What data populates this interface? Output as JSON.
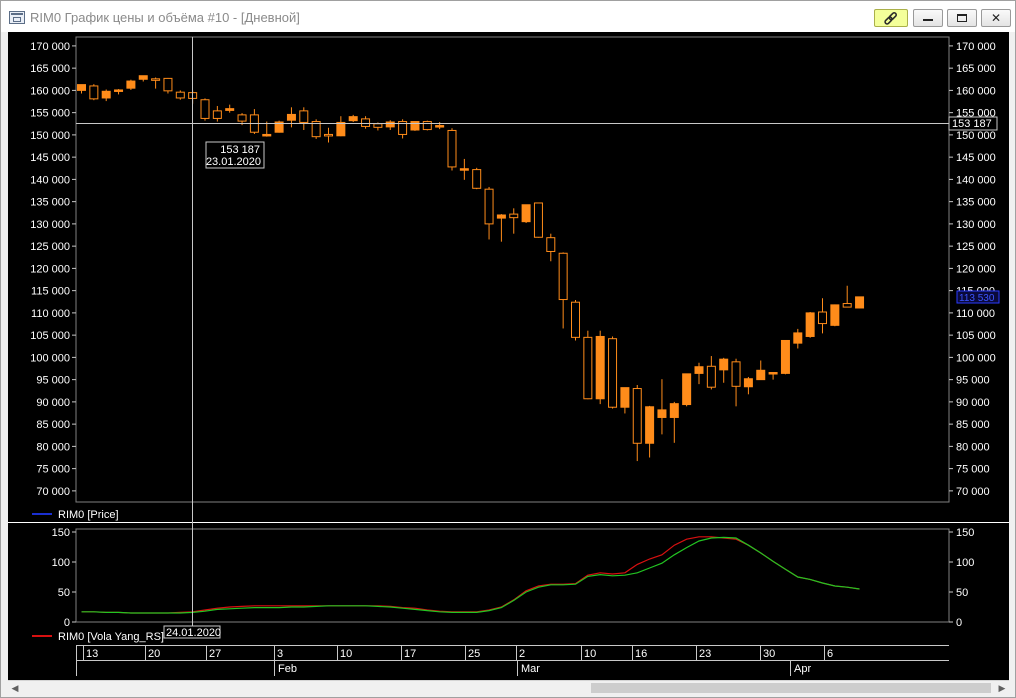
{
  "window": {
    "title": "RIM0 График цены и объёма #10 - [Дневной]"
  },
  "toolbar": {
    "link_icon": "link-icon",
    "minimize_icon": "minimize-icon",
    "maximize_icon": "maximize-icon",
    "close_icon": "close-icon"
  },
  "colors": {
    "background": "#000000",
    "grid": "#5a5a5a",
    "axis_text": "#ffffff",
    "candle_up": "#ff8c1a",
    "candle_down_border": "#ff8c1a",
    "crosshair": "#c8c8c8",
    "vola_red": "#d81010",
    "vola_green": "#22c422",
    "legend_blue": "#1a2fd0"
  },
  "crosshair": {
    "price_label": "153 187",
    "date_label": "23.01.2020",
    "bottom_date_label": "24.01.2020",
    "right_label": "153 187"
  },
  "last_price_label": "113 530",
  "chart_data": [
    {
      "type": "candlestick",
      "legend": "RIM0 [Price]",
      "y_ticks": [
        "70 000",
        "75 000",
        "80 000",
        "85 000",
        "90 000",
        "95 000",
        "100 000",
        "105 000",
        "110 000",
        "115 000",
        "120 000",
        "125 000",
        "130 000",
        "135 000",
        "140 000",
        "145 000",
        "150 000",
        "155 000",
        "160 000",
        "165 000",
        "170 000"
      ],
      "ylim": [
        67500,
        172000
      ],
      "candles": [
        {
          "o": 160000,
          "h": 161200,
          "l": 159300,
          "c": 161300
        },
        {
          "o": 161000,
          "h": 161400,
          "l": 157800,
          "c": 158100
        },
        {
          "o": 158300,
          "h": 160200,
          "l": 157600,
          "c": 159800
        },
        {
          "o": 159800,
          "h": 160300,
          "l": 159100,
          "c": 160100
        },
        {
          "o": 160500,
          "h": 162400,
          "l": 160100,
          "c": 162100
        },
        {
          "o": 162500,
          "h": 163300,
          "l": 162000,
          "c": 163300
        },
        {
          "o": 162600,
          "h": 162900,
          "l": 160400,
          "c": 162300
        },
        {
          "o": 162700,
          "h": 162800,
          "l": 159300,
          "c": 159900
        },
        {
          "o": 159600,
          "h": 160000,
          "l": 157900,
          "c": 158300
        },
        {
          "o": 159500,
          "h": 160000,
          "l": 157000,
          "c": 158200
        },
        {
          "o": 157900,
          "h": 158200,
          "l": 153200,
          "c": 153700
        },
        {
          "o": 155400,
          "h": 156500,
          "l": 153000,
          "c": 153700
        },
        {
          "o": 155500,
          "h": 156800,
          "l": 155000,
          "c": 155900
        },
        {
          "o": 154500,
          "h": 154900,
          "l": 152200,
          "c": 153100
        },
        {
          "o": 154500,
          "h": 155800,
          "l": 150200,
          "c": 150600
        },
        {
          "o": 149800,
          "h": 153000,
          "l": 149600,
          "c": 150100
        },
        {
          "o": 150600,
          "h": 153200,
          "l": 150500,
          "c": 152900
        },
        {
          "o": 153300,
          "h": 156200,
          "l": 151700,
          "c": 154600
        },
        {
          "o": 155400,
          "h": 156200,
          "l": 151100,
          "c": 152800
        },
        {
          "o": 153000,
          "h": 153500,
          "l": 149100,
          "c": 149600
        },
        {
          "o": 150100,
          "h": 151600,
          "l": 148300,
          "c": 149900
        },
        {
          "o": 149800,
          "h": 154200,
          "l": 149700,
          "c": 152800
        },
        {
          "o": 153200,
          "h": 154500,
          "l": 152900,
          "c": 154100
        },
        {
          "o": 153600,
          "h": 154200,
          "l": 151400,
          "c": 151900
        },
        {
          "o": 152500,
          "h": 152800,
          "l": 151000,
          "c": 151700
        },
        {
          "o": 151800,
          "h": 153300,
          "l": 151100,
          "c": 152900
        },
        {
          "o": 153000,
          "h": 153500,
          "l": 149200,
          "c": 150100
        },
        {
          "o": 151100,
          "h": 153000,
          "l": 150900,
          "c": 153000
        },
        {
          "o": 153000,
          "h": 153200,
          "l": 151000,
          "c": 151200
        },
        {
          "o": 151800,
          "h": 152900,
          "l": 151300,
          "c": 152100
        },
        {
          "o": 151000,
          "h": 151500,
          "l": 142000,
          "c": 142800
        },
        {
          "o": 142400,
          "h": 144600,
          "l": 139900,
          "c": 142400
        },
        {
          "o": 142200,
          "h": 142600,
          "l": 137800,
          "c": 138000
        },
        {
          "o": 137800,
          "h": 138300,
          "l": 126500,
          "c": 130000
        },
        {
          "o": 131300,
          "h": 132200,
          "l": 126000,
          "c": 132000
        },
        {
          "o": 132200,
          "h": 133500,
          "l": 127800,
          "c": 131400
        },
        {
          "o": 130500,
          "h": 134300,
          "l": 130200,
          "c": 134300
        },
        {
          "o": 134700,
          "h": 134800,
          "l": 126900,
          "c": 127000
        },
        {
          "o": 126900,
          "h": 127800,
          "l": 121600,
          "c": 123800
        },
        {
          "o": 123400,
          "h": 123600,
          "l": 106500,
          "c": 113000
        },
        {
          "o": 112400,
          "h": 112900,
          "l": 103800,
          "c": 104500
        },
        {
          "o": 104500,
          "h": 106000,
          "l": 90600,
          "c": 90700
        },
        {
          "o": 90700,
          "h": 106000,
          "l": 89500,
          "c": 104700
        },
        {
          "o": 104200,
          "h": 104700,
          "l": 88500,
          "c": 88800
        },
        {
          "o": 88800,
          "h": 93200,
          "l": 87400,
          "c": 93200
        },
        {
          "o": 93000,
          "h": 93800,
          "l": 76700,
          "c": 80700
        },
        {
          "o": 80700,
          "h": 89100,
          "l": 77500,
          "c": 88900
        },
        {
          "o": 86500,
          "h": 95100,
          "l": 82700,
          "c": 88200
        },
        {
          "o": 86500,
          "h": 90000,
          "l": 80800,
          "c": 89600
        },
        {
          "o": 89400,
          "h": 96300,
          "l": 89000,
          "c": 96300
        },
        {
          "o": 96400,
          "h": 98800,
          "l": 94000,
          "c": 97900
        },
        {
          "o": 98000,
          "h": 100300,
          "l": 92800,
          "c": 93300
        },
        {
          "o": 97200,
          "h": 99900,
          "l": 94300,
          "c": 99600
        },
        {
          "o": 99000,
          "h": 99700,
          "l": 89000,
          "c": 93500
        },
        {
          "o": 93400,
          "h": 95600,
          "l": 91700,
          "c": 95200
        },
        {
          "o": 95000,
          "h": 99300,
          "l": 95000,
          "c": 97100
        },
        {
          "o": 96500,
          "h": 96600,
          "l": 95000,
          "c": 96600
        },
        {
          "o": 96400,
          "h": 103800,
          "l": 96200,
          "c": 103800
        },
        {
          "o": 103200,
          "h": 106400,
          "l": 102000,
          "c": 105500
        },
        {
          "o": 104700,
          "h": 110200,
          "l": 104400,
          "c": 110000
        },
        {
          "o": 110200,
          "h": 113300,
          "l": 105400,
          "c": 107600
        },
        {
          "o": 107200,
          "h": 111900,
          "l": 107000,
          "c": 111800
        },
        {
          "o": 112100,
          "h": 116100,
          "l": 111300,
          "c": 111300
        },
        {
          "o": 111100,
          "h": 113600,
          "l": 111000,
          "c": 113600
        }
      ]
    },
    {
      "type": "line",
      "legend": "RIM0 [Vola Yang_RS]",
      "y_ticks": [
        "0",
        "50",
        "100",
        "150"
      ],
      "ylim": [
        0,
        155
      ],
      "series": [
        {
          "color": "#d81010",
          "values": [
            17,
            17,
            16,
            16,
            15,
            15,
            15,
            15,
            16,
            17,
            20,
            23,
            25,
            26,
            27,
            27,
            27,
            27,
            27,
            27,
            27,
            27,
            27,
            27,
            27,
            26,
            24,
            23,
            20,
            18,
            17,
            17,
            17,
            20,
            25,
            37,
            52,
            60,
            63,
            63,
            64,
            78,
            82,
            80,
            82,
            96,
            105,
            112,
            128,
            138,
            142,
            142,
            140,
            138,
            128,
            115,
            101,
            88,
            75,
            71,
            65,
            60,
            58,
            55
          ]
        },
        {
          "color": "#22c422",
          "values": [
            17,
            17,
            16,
            16,
            15,
            15,
            15,
            15,
            15,
            16,
            18,
            21,
            22,
            23,
            24,
            24,
            24,
            25,
            25,
            26,
            27,
            27,
            27,
            27,
            26,
            25,
            23,
            21,
            19,
            17,
            16,
            16,
            16,
            19,
            24,
            36,
            50,
            58,
            62,
            62,
            63,
            76,
            79,
            77,
            78,
            82,
            90,
            98,
            112,
            124,
            135,
            140,
            141,
            140,
            128,
            115,
            101,
            88,
            75,
            71,
            65,
            60,
            58,
            55
          ]
        }
      ]
    }
  ],
  "time_axis": {
    "day_labels": [
      "13",
      "20",
      "27",
      "3",
      "10",
      "17",
      "25",
      "2",
      "10",
      "16",
      "23",
      "30",
      "6"
    ],
    "month_labels": [
      "Feb",
      "Mar",
      "Apr"
    ]
  }
}
